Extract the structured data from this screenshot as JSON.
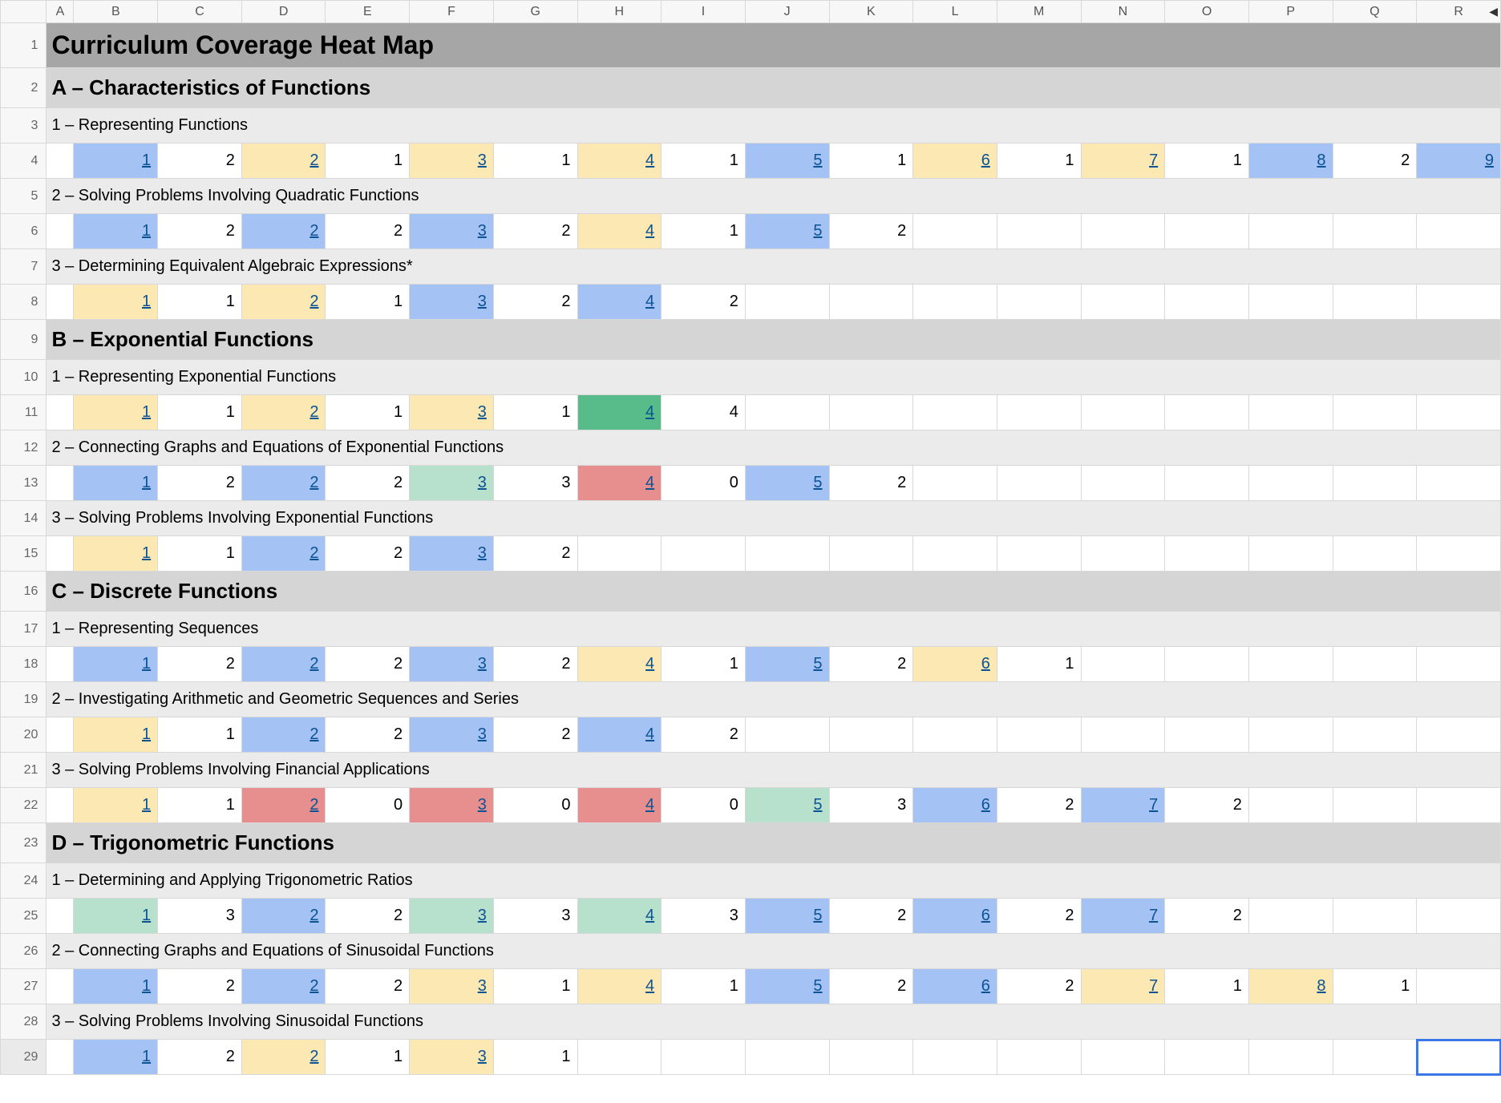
{
  "columns": [
    "A",
    "B",
    "C",
    "D",
    "E",
    "F",
    "G",
    "H",
    "I",
    "J",
    "K",
    "L",
    "M",
    "N",
    "O",
    "P",
    "Q",
    "R"
  ],
  "rowNumbers": [
    "1",
    "2",
    "3",
    "4",
    "5",
    "6",
    "7",
    "8",
    "9",
    "10",
    "11",
    "12",
    "13",
    "14",
    "15",
    "16",
    "17",
    "18",
    "19",
    "20",
    "21",
    "22",
    "23",
    "24",
    "25",
    "26",
    "27",
    "28",
    "29"
  ],
  "rows": [
    {
      "type": "title",
      "text": "Curriculum Coverage Heat Map"
    },
    {
      "type": "section",
      "text": "A – Characteristics of Functions"
    },
    {
      "type": "subhdr",
      "text": "1 – Representing Functions"
    },
    {
      "type": "data",
      "cells": [
        [
          "1",
          "link",
          "h-blue"
        ],
        [
          "2",
          "",
          ""
        ],
        [
          "2",
          "link",
          "h-cream"
        ],
        [
          "1",
          "",
          ""
        ],
        [
          "3",
          "link",
          "h-cream"
        ],
        [
          "1",
          "",
          ""
        ],
        [
          "4",
          "link",
          "h-cream"
        ],
        [
          "1",
          "",
          ""
        ],
        [
          "5",
          "link",
          "h-blue"
        ],
        [
          "1",
          "",
          ""
        ],
        [
          "6",
          "link",
          "h-cream"
        ],
        [
          "1",
          "",
          ""
        ],
        [
          "7",
          "link",
          "h-cream"
        ],
        [
          "1",
          "",
          ""
        ],
        [
          "8",
          "link",
          "h-blue"
        ],
        [
          "2",
          "",
          ""
        ],
        [
          "9",
          "link",
          "h-blue"
        ]
      ]
    },
    {
      "type": "subhdr",
      "text": "2 – Solving Problems Involving Quadratic Functions"
    },
    {
      "type": "data",
      "cells": [
        [
          "1",
          "link",
          "h-blue"
        ],
        [
          "2",
          "",
          ""
        ],
        [
          "2",
          "link",
          "h-blue"
        ],
        [
          "2",
          "",
          ""
        ],
        [
          "3",
          "link",
          "h-blue"
        ],
        [
          "2",
          "",
          ""
        ],
        [
          "4",
          "link",
          "h-cream"
        ],
        [
          "1",
          "",
          ""
        ],
        [
          "5",
          "link",
          "h-blue"
        ],
        [
          "2",
          "",
          ""
        ]
      ]
    },
    {
      "type": "subhdr",
      "text": "3 – Determining Equivalent Algebraic Expressions*"
    },
    {
      "type": "data",
      "cells": [
        [
          "1",
          "link",
          "h-cream"
        ],
        [
          "1",
          "",
          ""
        ],
        [
          "2",
          "link",
          "h-cream"
        ],
        [
          "1",
          "",
          ""
        ],
        [
          "3",
          "link",
          "h-blue"
        ],
        [
          "2",
          "",
          ""
        ],
        [
          "4",
          "link",
          "h-blue"
        ],
        [
          "2",
          "",
          ""
        ]
      ]
    },
    {
      "type": "section",
      "text": "B – Exponential Functions"
    },
    {
      "type": "subhdr",
      "text": "1 – Representing Exponential Functions"
    },
    {
      "type": "data",
      "cells": [
        [
          "1",
          "link",
          "h-cream"
        ],
        [
          "1",
          "",
          ""
        ],
        [
          "2",
          "link",
          "h-cream"
        ],
        [
          "1",
          "",
          ""
        ],
        [
          "3",
          "link",
          "h-cream"
        ],
        [
          "1",
          "",
          ""
        ],
        [
          "4",
          "link",
          "h-dgreen"
        ],
        [
          "4",
          "",
          ""
        ]
      ]
    },
    {
      "type": "subhdr",
      "text": "2 – Connecting Graphs and Equations of Exponential Functions"
    },
    {
      "type": "data",
      "cells": [
        [
          "1",
          "link",
          "h-blue"
        ],
        [
          "2",
          "",
          ""
        ],
        [
          "2",
          "link",
          "h-blue"
        ],
        [
          "2",
          "",
          ""
        ],
        [
          "3",
          "link",
          "h-green"
        ],
        [
          "3",
          "",
          ""
        ],
        [
          "4",
          "link",
          "h-red"
        ],
        [
          "0",
          "",
          ""
        ],
        [
          "5",
          "link",
          "h-blue"
        ],
        [
          "2",
          "",
          ""
        ]
      ]
    },
    {
      "type": "subhdr",
      "text": "3 – Solving Problems Involving Exponential Functions"
    },
    {
      "type": "data",
      "cells": [
        [
          "1",
          "link",
          "h-cream"
        ],
        [
          "1",
          "",
          ""
        ],
        [
          "2",
          "link",
          "h-blue"
        ],
        [
          "2",
          "",
          ""
        ],
        [
          "3",
          "link",
          "h-blue"
        ],
        [
          "2",
          "",
          ""
        ]
      ]
    },
    {
      "type": "section",
      "text": "C – Discrete Functions"
    },
    {
      "type": "subhdr",
      "text": "1 – Representing Sequences"
    },
    {
      "type": "data",
      "cells": [
        [
          "1",
          "link",
          "h-blue"
        ],
        [
          "2",
          "",
          ""
        ],
        [
          "2",
          "link",
          "h-blue"
        ],
        [
          "2",
          "",
          ""
        ],
        [
          "3",
          "link",
          "h-blue"
        ],
        [
          "2",
          "",
          ""
        ],
        [
          "4",
          "link",
          "h-cream"
        ],
        [
          "1",
          "",
          ""
        ],
        [
          "5",
          "link",
          "h-blue"
        ],
        [
          "2",
          "",
          ""
        ],
        [
          "6",
          "link",
          "h-cream"
        ],
        [
          "1",
          "",
          ""
        ]
      ]
    },
    {
      "type": "subhdr",
      "text": "2 – Investigating Arithmetic and Geometric Sequences and Series"
    },
    {
      "type": "data",
      "cells": [
        [
          "1",
          "link",
          "h-cream"
        ],
        [
          "1",
          "",
          ""
        ],
        [
          "2",
          "link",
          "h-blue"
        ],
        [
          "2",
          "",
          ""
        ],
        [
          "3",
          "link",
          "h-blue"
        ],
        [
          "2",
          "",
          ""
        ],
        [
          "4",
          "link",
          "h-blue"
        ],
        [
          "2",
          "",
          ""
        ]
      ]
    },
    {
      "type": "subhdr",
      "text": "3 – Solving Problems Involving Financial Applications"
    },
    {
      "type": "data",
      "cells": [
        [
          "1",
          "link",
          "h-cream"
        ],
        [
          "1",
          "",
          ""
        ],
        [
          "2",
          "link",
          "h-red"
        ],
        [
          "0",
          "",
          ""
        ],
        [
          "3",
          "link",
          "h-red"
        ],
        [
          "0",
          "",
          ""
        ],
        [
          "4",
          "link",
          "h-red"
        ],
        [
          "0",
          "",
          ""
        ],
        [
          "5",
          "link",
          "h-green"
        ],
        [
          "3",
          "",
          ""
        ],
        [
          "6",
          "link",
          "h-blue"
        ],
        [
          "2",
          "",
          ""
        ],
        [
          "7",
          "link",
          "h-blue"
        ],
        [
          "2",
          "",
          ""
        ]
      ]
    },
    {
      "type": "section",
      "text": "D – Trigonometric Functions"
    },
    {
      "type": "subhdr",
      "text": "1 – Determining and Applying Trigonometric Ratios"
    },
    {
      "type": "data",
      "cells": [
        [
          "1",
          "link",
          "h-green"
        ],
        [
          "3",
          "",
          ""
        ],
        [
          "2",
          "link",
          "h-blue"
        ],
        [
          "2",
          "",
          ""
        ],
        [
          "3",
          "link",
          "h-green"
        ],
        [
          "3",
          "",
          ""
        ],
        [
          "4",
          "link",
          "h-green"
        ],
        [
          "3",
          "",
          ""
        ],
        [
          "5",
          "link",
          "h-blue"
        ],
        [
          "2",
          "",
          ""
        ],
        [
          "6",
          "link",
          "h-blue"
        ],
        [
          "2",
          "",
          ""
        ],
        [
          "7",
          "link",
          "h-blue"
        ],
        [
          "2",
          "",
          ""
        ]
      ]
    },
    {
      "type": "subhdr",
      "text": "2 – Connecting Graphs and Equations of Sinusoidal Functions"
    },
    {
      "type": "data",
      "cells": [
        [
          "1",
          "link",
          "h-blue"
        ],
        [
          "2",
          "",
          ""
        ],
        [
          "2",
          "link",
          "h-blue"
        ],
        [
          "2",
          "",
          ""
        ],
        [
          "3",
          "link",
          "h-cream"
        ],
        [
          "1",
          "",
          ""
        ],
        [
          "4",
          "link",
          "h-cream"
        ],
        [
          "1",
          "",
          ""
        ],
        [
          "5",
          "link",
          "h-blue"
        ],
        [
          "2",
          "",
          ""
        ],
        [
          "6",
          "link",
          "h-blue"
        ],
        [
          "2",
          "",
          ""
        ],
        [
          "7",
          "link",
          "h-cream"
        ],
        [
          "1",
          "",
          ""
        ],
        [
          "8",
          "link",
          "h-cream"
        ],
        [
          "1",
          "",
          ""
        ]
      ]
    },
    {
      "type": "subhdr",
      "text": "3 – Solving Problems Involving Sinusoidal Functions"
    },
    {
      "type": "data",
      "cells": [
        [
          "1",
          "link",
          "h-blue"
        ],
        [
          "2",
          "",
          ""
        ],
        [
          "2",
          "link",
          "h-cream"
        ],
        [
          "1",
          "",
          ""
        ],
        [
          "3",
          "link",
          "h-cream"
        ],
        [
          "1",
          "",
          ""
        ]
      ]
    }
  ],
  "selectedCell": {
    "row": 29,
    "col": "R"
  }
}
